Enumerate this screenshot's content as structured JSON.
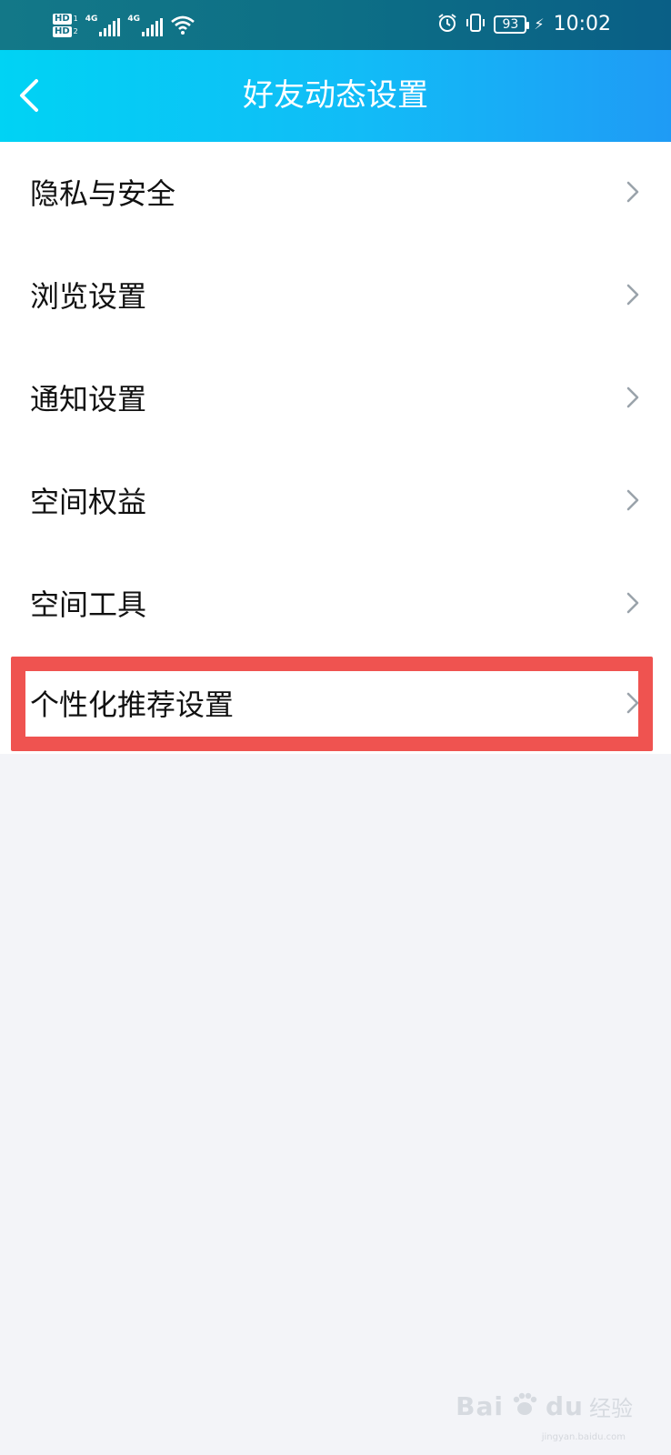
{
  "status_bar": {
    "hd_1": "HD",
    "hd_1_sub": "1",
    "hd_2": "HD",
    "hd_2_sub": "2",
    "net_1": "4G",
    "net_2": "4G",
    "battery": "93",
    "time": "10:02",
    "icons": [
      "signal-icon",
      "wifi-icon",
      "alarm-icon",
      "vibrate-icon",
      "battery-icon",
      "charging-icon"
    ]
  },
  "header": {
    "title": "好友动态设置",
    "back_icon": "chevron-left-icon"
  },
  "menu": {
    "items": [
      {
        "label": "隐私与安全"
      },
      {
        "label": "浏览设置"
      },
      {
        "label": "通知设置"
      },
      {
        "label": "空间权益"
      },
      {
        "label": "空间工具"
      },
      {
        "label": "个性化推荐设置",
        "highlighted": true
      }
    ],
    "chevron_icon": "chevron-right-icon"
  },
  "watermark": {
    "brand": "Bai",
    "brand2": "du",
    "cn": "经验",
    "sub": "jingyan.baidu.com"
  },
  "colors": {
    "header_gradient_start": "#00d3f4",
    "header_gradient_end": "#1f9bf5",
    "statusbar": "#0f6f86",
    "highlight": "#ef5350",
    "page_bg": "#f3f4f8",
    "chevron": "#9aa3ab"
  }
}
